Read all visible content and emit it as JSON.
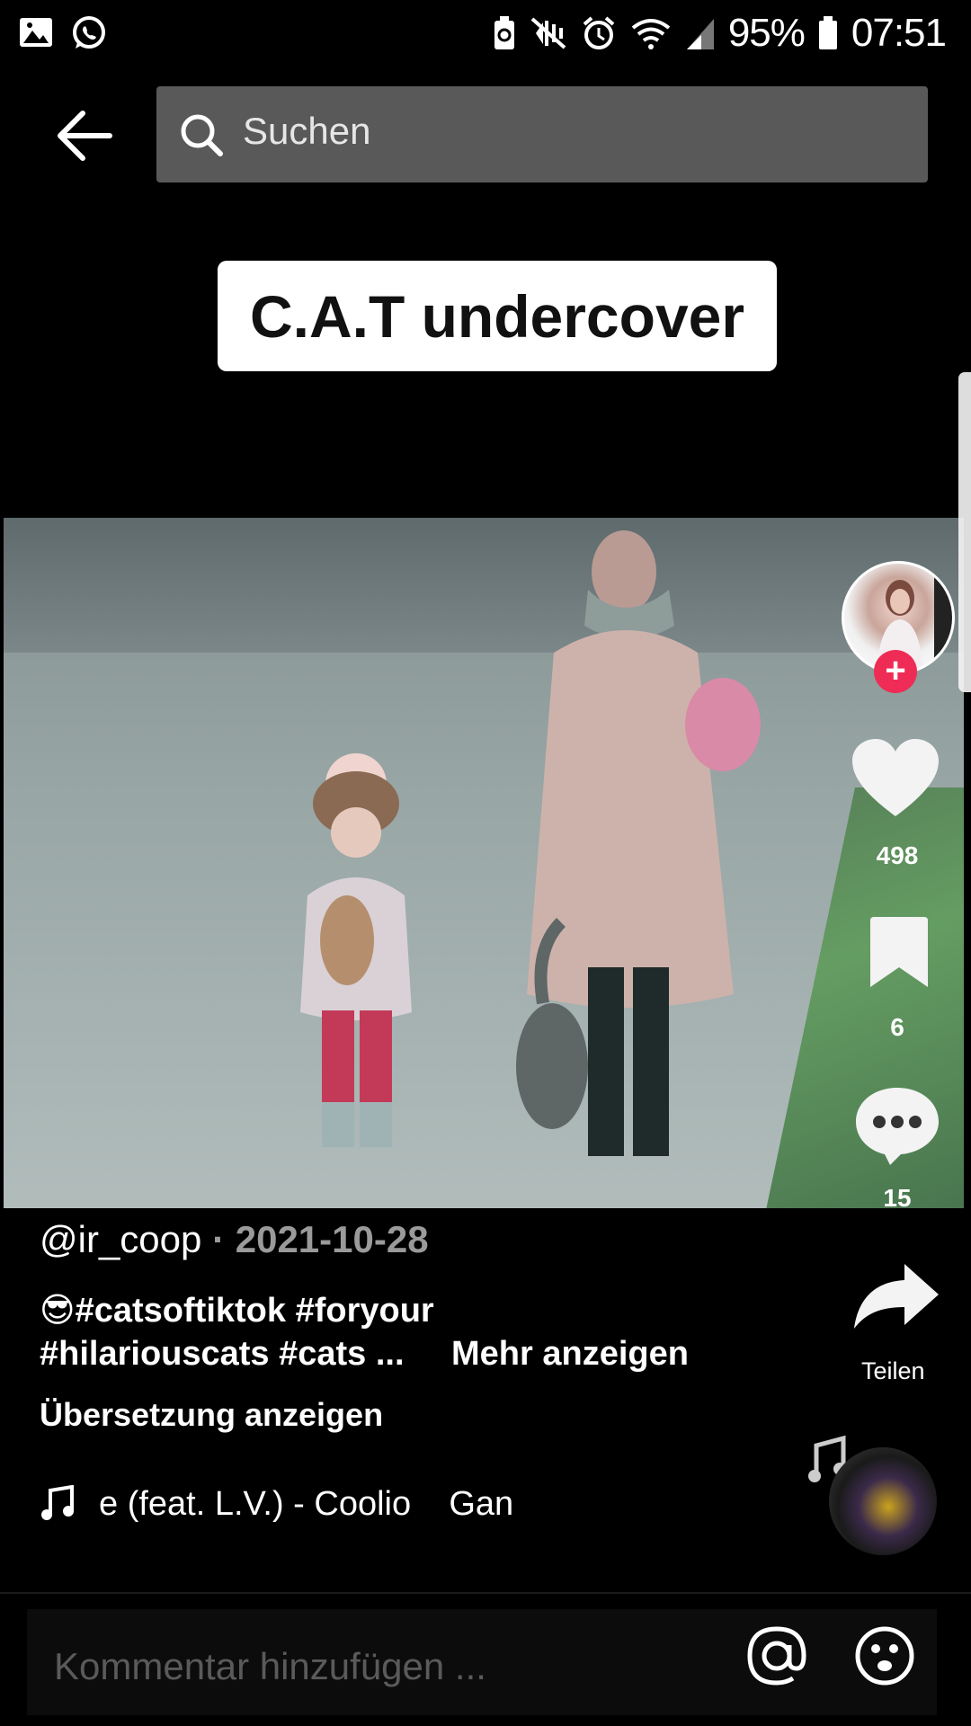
{
  "status_bar": {
    "battery_percent": "95%",
    "time": "07:51",
    "left_icons": [
      "gallery-icon",
      "whatsapp-icon"
    ],
    "right_icons": [
      "battery-saver-icon",
      "mute-icon",
      "alarm-icon",
      "wifi-icon",
      "signal-icon",
      "battery-icon"
    ]
  },
  "top_bar": {
    "back_icon": "back-arrow-icon",
    "search_placeholder": "Suchen"
  },
  "video": {
    "caption": "C.A.T undercover"
  },
  "rail": {
    "like_count": "498",
    "save_count": "6",
    "comment_count": "15",
    "share_label": "Teilen"
  },
  "post": {
    "username": "@ir_coop",
    "separator": "·",
    "date": "2021-10-28",
    "desc_line1": "😎#catsoftiktok #foryour",
    "desc_line2": "#hilariouscats #cats ...",
    "more_label": "Mehr anzeigen",
    "translate_label": "Übersetzung anzeigen",
    "music_text": "e (feat. L.V.) - Coolio    Gan"
  },
  "comment_bar": {
    "placeholder": "Kommentar hinzufügen ..."
  },
  "colors": {
    "background": "#000000",
    "search_bg": "#595959",
    "follow_red": "#ee2c55",
    "muted_text": "#9a9a9a"
  }
}
